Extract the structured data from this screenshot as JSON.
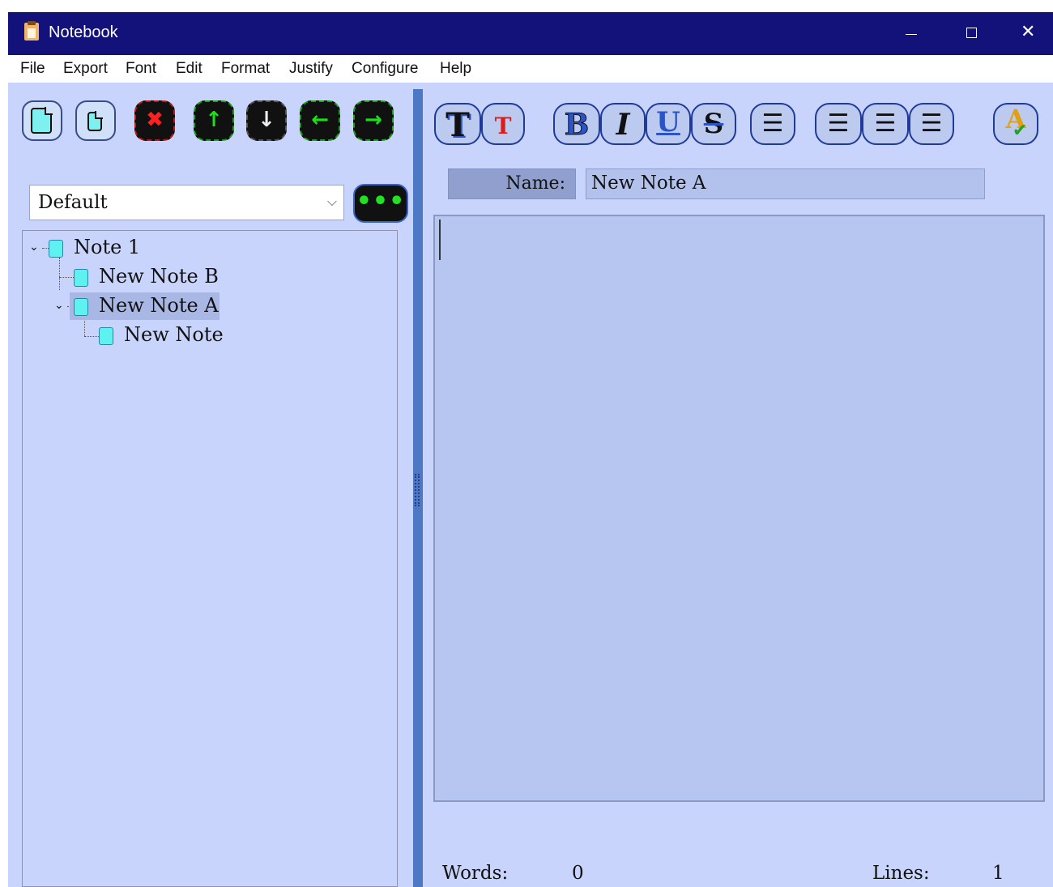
{
  "window": {
    "title": "Notebook"
  },
  "menu": [
    "File",
    "Export",
    "Font",
    "Edit",
    "Format",
    "Justify",
    "Configure",
    "Help"
  ],
  "notebook_select": {
    "value": "Default"
  },
  "more_button_glyph": "•••",
  "tree": [
    {
      "label": "Note 1",
      "depth": 0,
      "expanded": true,
      "selected": false
    },
    {
      "label": "New Note B",
      "depth": 1,
      "expanded": false,
      "selected": false
    },
    {
      "label": "New Note A",
      "depth": 1,
      "expanded": true,
      "selected": true
    },
    {
      "label": "New Note",
      "depth": 2,
      "expanded": false,
      "selected": false
    }
  ],
  "name_field": {
    "label": "Name:",
    "value": "New Note A"
  },
  "editor": {
    "content": ""
  },
  "status": {
    "words_label": "Words:",
    "words_value": "0",
    "lines_label": "Lines:",
    "lines_value": "1"
  },
  "colors": {
    "title_bar": "#12127a",
    "window_background": "#c8d4fc",
    "editor_background": "#b7c6f0",
    "splitter": "#4d78c6",
    "tree_selection": "#a9b7e4",
    "doc_icon": "#5ff0f0",
    "accent_green": "#19e019",
    "accent_red": "#ff2020"
  },
  "icons": {
    "note_toolbar": [
      "new-note-icon",
      "new-child-note-icon",
      "delete-note-icon",
      "move-up-icon",
      "move-down-icon",
      "move-left-icon",
      "move-right-icon"
    ],
    "format_toolbar": [
      "font-size-large-icon",
      "text-color-icon",
      "bold-icon",
      "italic-icon",
      "underline-icon",
      "strikethrough-icon",
      "bullet-list-icon",
      "align-left-icon",
      "align-center-icon",
      "align-right-icon",
      "spell-check-icon"
    ]
  }
}
